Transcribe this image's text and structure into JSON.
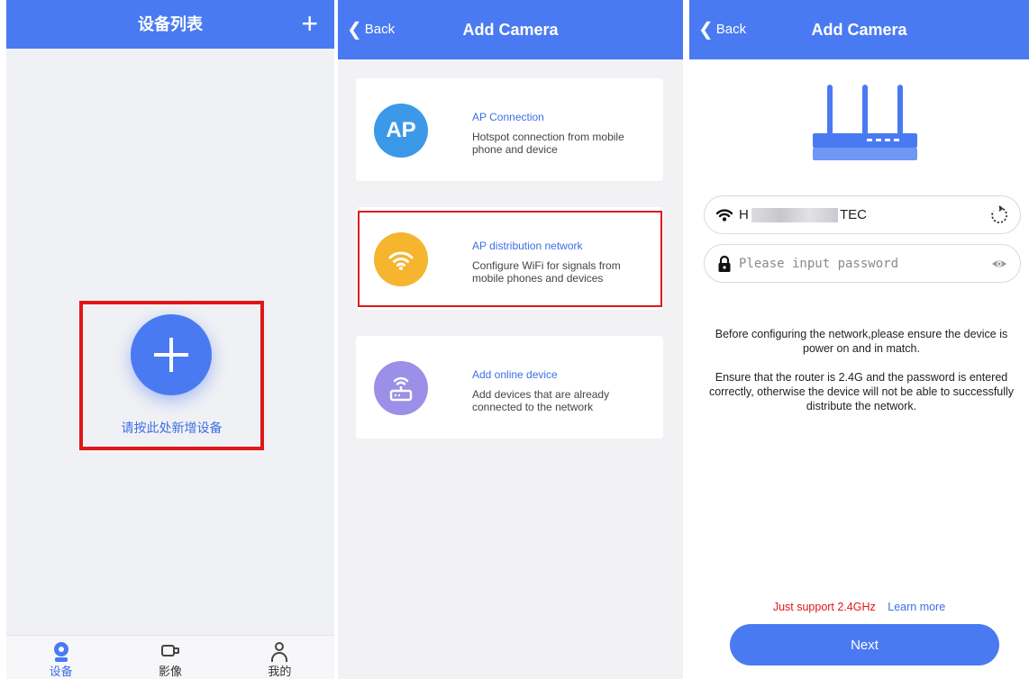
{
  "panel_device_list": {
    "title": "设备列表",
    "add_icon": "plus-icon",
    "add_hint": "请按此处新增设备",
    "tabs": [
      {
        "label": "设备",
        "icon": "camera-icon",
        "active": true
      },
      {
        "label": "影像",
        "icon": "video-icon",
        "active": false
      },
      {
        "label": "我的",
        "icon": "user-icon",
        "active": false
      }
    ]
  },
  "panel_add_camera": {
    "back_label": "Back",
    "title": "Add Camera",
    "options": [
      {
        "icon_text": "AP",
        "icon": "ap-icon",
        "color": "#3b99e8",
        "title": "AP Connection",
        "desc": "Hotspot connection from mobile phone and device"
      },
      {
        "icon": "wifi-icon",
        "color": "#f5b52e",
        "title": "AP distribution network",
        "desc": "Configure WiFi for signals from mobile phones and devices"
      },
      {
        "icon": "router-icon",
        "color": "#9b8fe8",
        "title": "Add online device",
        "desc": "Add devices that are already connected to the network"
      }
    ]
  },
  "panel_wifi": {
    "back_label": "Back",
    "title": "Add Camera",
    "ssid_prefix": "H",
    "ssid_suffix": "TEC",
    "password_placeholder": "Please input password",
    "note1": "Before configuring the network,please ensure the device is power on and in match.",
    "note2": "Ensure that the router is 2.4G and the password is entered correctly, otherwise the device will not be able to successfully distribute the network.",
    "support_text": "Just support 2.4GHz",
    "learn_more": "Learn more",
    "next_label": "Next"
  },
  "colors": {
    "brand": "#4a7af2",
    "highlight": "#e01717",
    "link": "#3d6fe6"
  }
}
